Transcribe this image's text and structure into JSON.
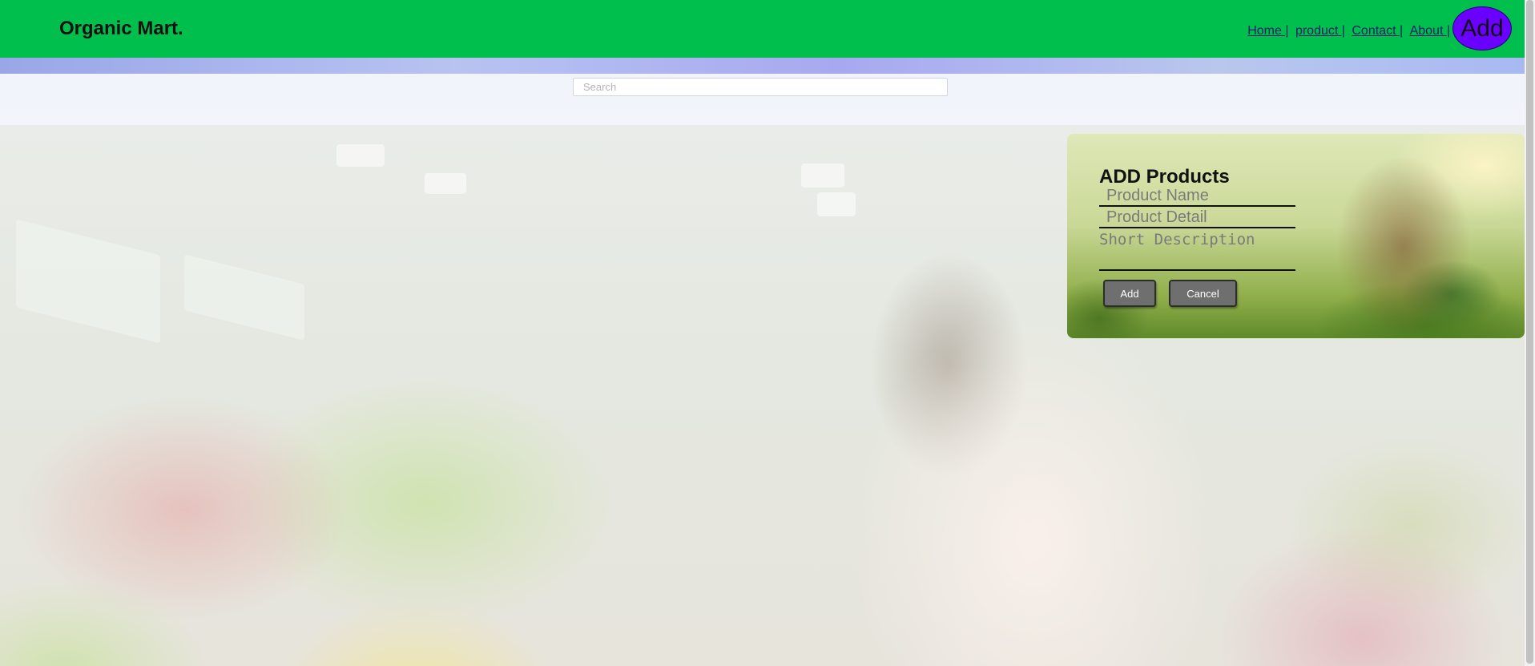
{
  "header": {
    "brand": "Organic Mart.",
    "nav": [
      {
        "label": "Home |"
      },
      {
        "label": "product |"
      },
      {
        "label": "Contact |"
      },
      {
        "label": "About |"
      }
    ],
    "add_button_label": "Add",
    "background_color": "#00bf4c",
    "add_button_color": "#6a00ff"
  },
  "search": {
    "placeholder": "Search",
    "value": ""
  },
  "add_product_form": {
    "title": "ADD Products",
    "product_name_placeholder": "Product Name",
    "product_detail_placeholder": "Product Detail",
    "short_description_placeholder": "Short Description",
    "add_label": "Add",
    "cancel_label": "Cancel"
  },
  "icons": [
    "hero-background-image",
    "farmer-image"
  ]
}
